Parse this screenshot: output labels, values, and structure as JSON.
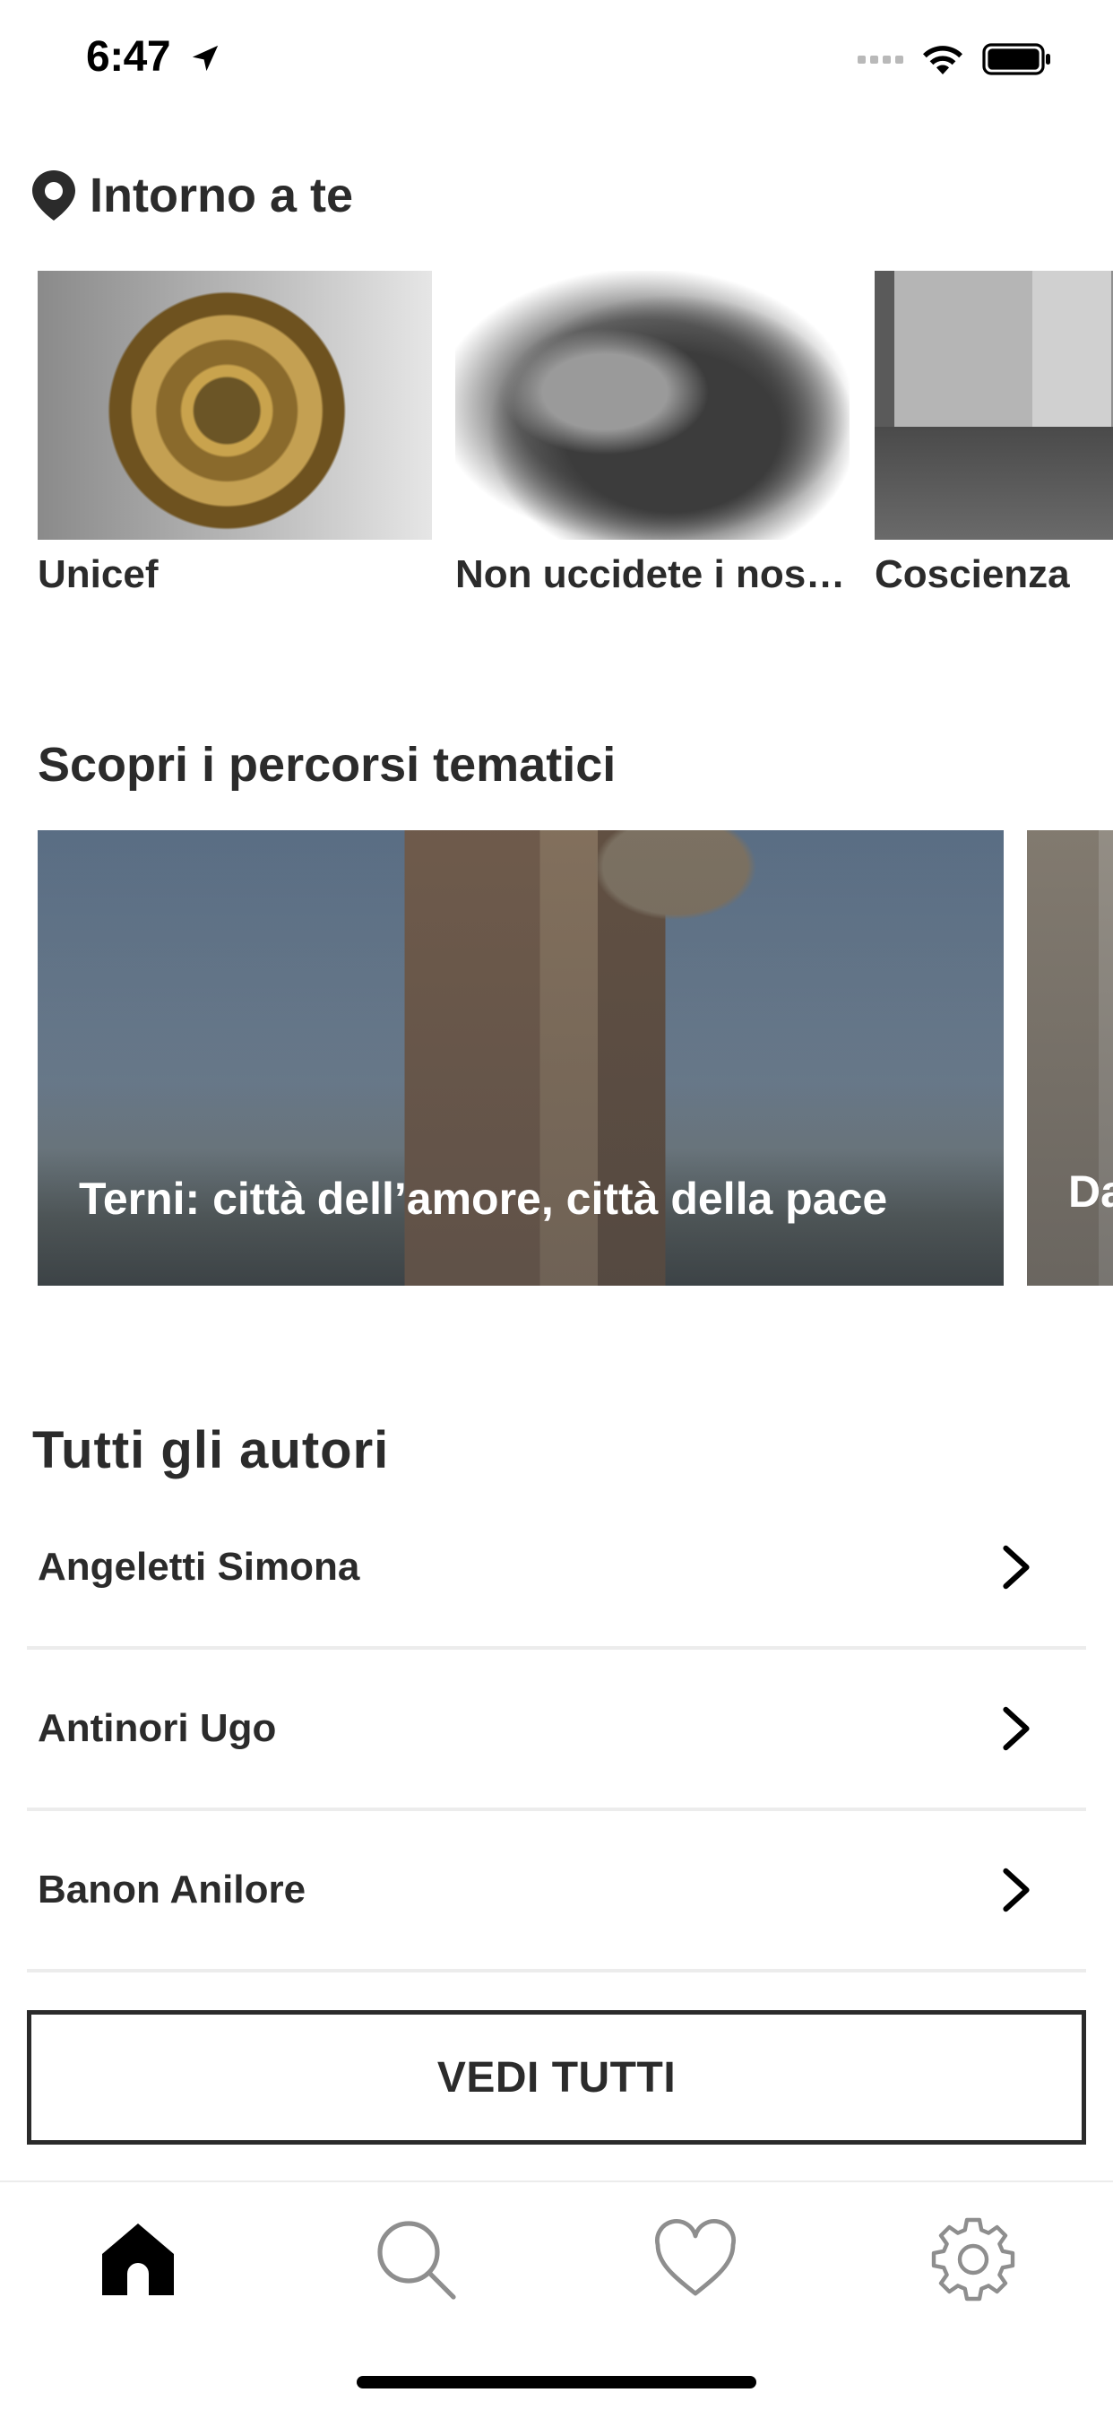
{
  "status_bar": {
    "time": "6:47"
  },
  "near_you": {
    "title": "Intorno a te",
    "items": [
      {
        "label": "Unicef"
      },
      {
        "label": "Non uccidete i nos…"
      },
      {
        "label": "Coscienza"
      }
    ]
  },
  "routes": {
    "title": "Scopri i percorsi tematici",
    "items": [
      {
        "title": "Terni: città dell’amore, città della pace"
      },
      {
        "title": "Da Ma"
      }
    ]
  },
  "authors": {
    "title": "Tutti gli autori",
    "items": [
      {
        "name": "Angeletti Simona"
      },
      {
        "name": "Antinori Ugo"
      },
      {
        "name": "Banon Anilore"
      }
    ],
    "see_all_label": "VEDI TUTTI"
  },
  "tab_bar": {
    "tabs": [
      {
        "icon": "home-icon",
        "active": true
      },
      {
        "icon": "search-icon",
        "active": false
      },
      {
        "icon": "heart-icon",
        "active": false
      },
      {
        "icon": "gear-icon",
        "active": false
      }
    ]
  },
  "colors": {
    "text": "#2b2b2b",
    "divider": "#ececec",
    "background": "#ffffff",
    "active_icon": "#000000",
    "inactive_icon": "#8e8e8e"
  }
}
